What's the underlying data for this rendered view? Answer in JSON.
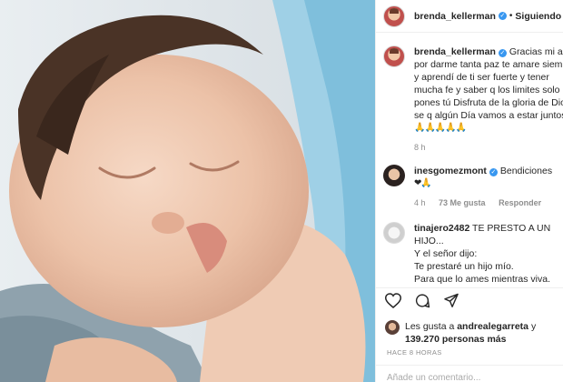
{
  "post_author": {
    "username": "brenda_kellerman",
    "verified": true,
    "separator": "•",
    "follow_state": "Siguiendo"
  },
  "caption": {
    "username": "brenda_kellerman",
    "lines": [
      "Gracias mi amor",
      "por darme tanta paz te amare siempre",
      "y aprendí de ti ser fuerte y tener",
      "mucha fe y saber q los limites solo",
      "pones tú Disfruta de la gloria de Dios",
      "se q algún Día vamos a estar juntos"
    ],
    "emojis": "🙏🙏🙏🙏🙏",
    "age": "8 h"
  },
  "comments": [
    {
      "username": "inesgomezmont",
      "verified": true,
      "text": "Bendiciones",
      "emojis": "❤🙏",
      "age": "4 h",
      "likes": "73 Me gusta",
      "reply_label": "Responder"
    },
    {
      "username": "tinajero2482",
      "lines": [
        "TE PRESTO A UN",
        "HIJO...",
        "Y el señor dijo:",
        "Te prestaré un hijo mío.",
        "Para que lo ames mientras viva."
      ]
    }
  ],
  "likes_summary": {
    "prefix": "Les gusta a",
    "user": "andrealegarreta",
    "conj": "y",
    "count": "139.270 personas más"
  },
  "timestamp": "HACE 8 HORAS",
  "add_comment_placeholder": "Añade un comentario...",
  "icons": [
    "heart-icon",
    "comment-icon",
    "share-icon",
    "verified-icon"
  ],
  "colors": {
    "verified": "#3897f0",
    "muted": "#8e8e8e",
    "heart": "#ed4956"
  }
}
